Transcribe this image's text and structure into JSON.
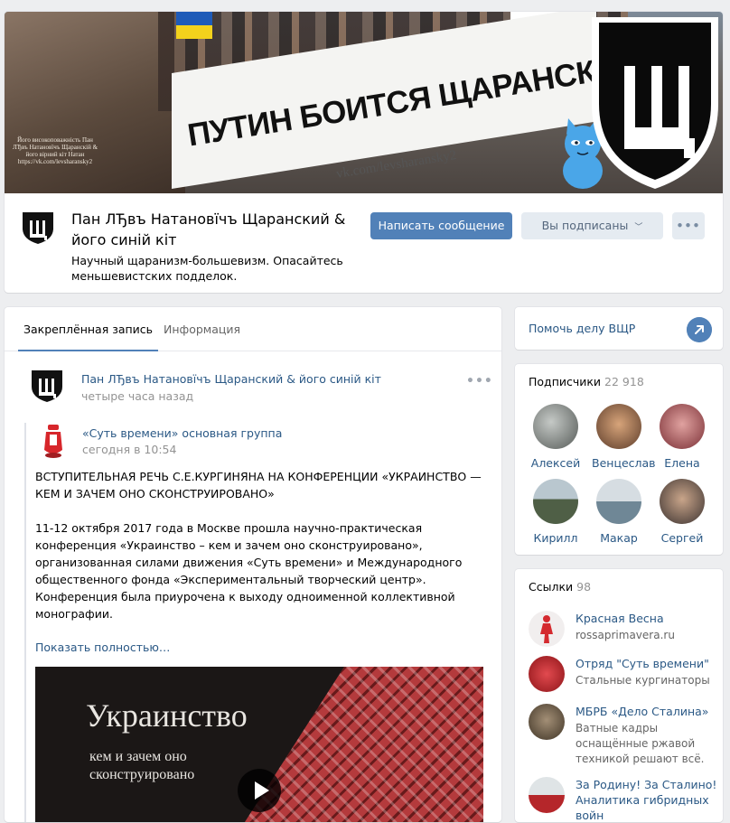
{
  "header": {
    "cover": {
      "banner_text": "ПУТИН БОИТСЯ ЩАРАНСКАГО",
      "banner_url": "vk.com/levsharansky2",
      "monument_caption": "Його високоповажність Пан ЛЂвъ Натановїчъ Щаранскій & його вірний кіт Натан https://vk.com/levsharansky2"
    },
    "name": "Пан ЛЂвъ Натановїчъ Щаранский & його синій кіт",
    "status": "Научный щаранизм-большевизм. Опасайтесь меньшевистских подделок.",
    "buttons": {
      "message": "Написать сообщение",
      "subscribed": "Вы подписаны",
      "more": "•••"
    }
  },
  "wall": {
    "tabs": [
      {
        "label": "Закреплённая запись"
      },
      {
        "label": "Информация"
      }
    ],
    "post": {
      "author": "Пан ЛЂвъ Натановїчъ Щаранский & його синій кіт",
      "time": "четыре часа назад",
      "menu": "•••",
      "repost": {
        "author": "«Суть времени» основная группа",
        "time": "сегодня в 10:54"
      },
      "text": {
        "p1": "ВСТУПИТЕЛЬНАЯ РЕЧЬ С.Е.КУРГИНЯНА НА КОНФЕРЕНЦИИ «УКРАИНСТВО — КЕМ И ЗАЧЕМ ОНО СКОНСТРУИРОВАНО»",
        "p2a": "11-12 октября 2017 года в Москве прошла научно-практическая конференция «Украинство – кем и зачем оно сконструировано», организованная силами движения «Суть времени» и Международного общественного фонда «Экспериментальный творческий центр».",
        "p2b": "Конференция была приурочена к выходу одноименной коллективной монографии."
      },
      "show_more": "Показать полностью…",
      "video": {
        "title": "Украинство",
        "subtitle": "кем и зачем оно сконструировано"
      }
    }
  },
  "sidebar": {
    "help": {
      "label": "Помочь делу ВЩР"
    },
    "subscribers": {
      "title": "Подписчики",
      "count": "22 918",
      "items": [
        {
          "name": "Алексей",
          "color": "#8a8f8c"
        },
        {
          "name": "Венцеслав",
          "color": "#9b6a4a"
        },
        {
          "name": "Елена",
          "color": "#b06a6a"
        },
        {
          "name": "Кирилл",
          "color": "#6b7d6a"
        },
        {
          "name": "Макар",
          "color": "#9aa8b3"
        },
        {
          "name": "Сергей",
          "color": "#7b6a5e"
        }
      ]
    },
    "links": {
      "title": "Ссылки",
      "count": "98",
      "items": [
        {
          "title": "Красная Весна",
          "desc": "rossaprimavera.ru",
          "color": "#e8e0e0"
        },
        {
          "title": "Отряд \"Суть времени\"",
          "desc": "Стальные кургинаторы",
          "color": "#c8262c"
        },
        {
          "title": "МБРБ «Дело Сталина»",
          "desc": "Ватные кадры оснащённые ржавой техникой решают всё.",
          "color": "#6b5a45"
        },
        {
          "title": "За Родину! За Сталино! Аналитика гибридных войн",
          "desc": "",
          "color": "#c9d2d6"
        }
      ]
    }
  }
}
